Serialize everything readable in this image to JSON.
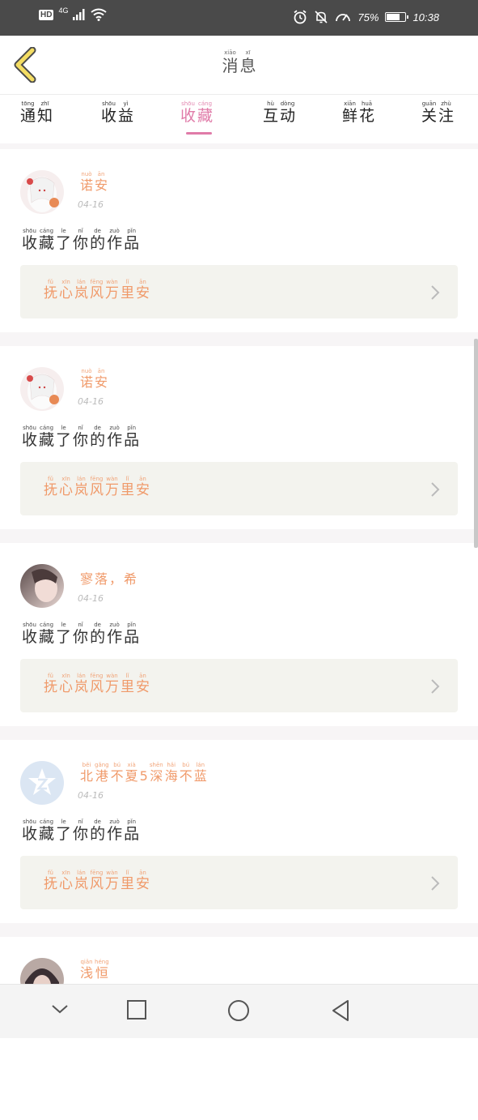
{
  "status_bar": {
    "hd": "HD",
    "network": "4G",
    "battery": "75%",
    "battery_level": 0.75,
    "time": "10:38",
    "icons": [
      "signal-icon",
      "wifi-icon",
      "alarm-icon",
      "mute-icon",
      "speed-icon",
      "battery-icon"
    ]
  },
  "header": {
    "title": [
      {
        "ch": "消",
        "py": "xiāo"
      },
      {
        "ch": "息",
        "py": "xī"
      }
    ],
    "back_icon": "chevron-left-icon"
  },
  "tabs": [
    {
      "label": [
        {
          "ch": "通",
          "py": "tōng"
        },
        {
          "ch": "知",
          "py": "zhī"
        }
      ],
      "active": false
    },
    {
      "label": [
        {
          "ch": "收",
          "py": "shōu"
        },
        {
          "ch": "益",
          "py": "yì"
        }
      ],
      "active": false
    },
    {
      "label": [
        {
          "ch": "收",
          "py": "shōu"
        },
        {
          "ch": "藏",
          "py": "cáng"
        }
      ],
      "active": true
    },
    {
      "label": [
        {
          "ch": "互",
          "py": "hù"
        },
        {
          "ch": "动",
          "py": "dòng"
        }
      ],
      "active": false
    },
    {
      "label": [
        {
          "ch": "鲜",
          "py": "xiān"
        },
        {
          "ch": "花",
          "py": "huā"
        }
      ],
      "active": false
    },
    {
      "label": [
        {
          "ch": "关",
          "py": "guān"
        },
        {
          "ch": "注",
          "py": "zhù"
        }
      ],
      "active": false
    }
  ],
  "colors": {
    "accent": "#e07ba8",
    "name": "#f09a6a",
    "box": "#f3f3ee"
  },
  "items": [
    {
      "user": [
        {
          "ch": "诺",
          "py": "nuò"
        },
        {
          "ch": "安",
          "py": "ān"
        }
      ],
      "avatar": "anime-girl-avatar",
      "date": "04-16",
      "action": [
        {
          "ch": "收",
          "py": "shōu"
        },
        {
          "ch": "藏",
          "py": "cáng"
        },
        {
          "ch": "了",
          "py": "le"
        },
        {
          "ch": "你",
          "py": "nǐ"
        },
        {
          "ch": "的",
          "py": "de"
        },
        {
          "ch": "作",
          "py": "zuò"
        },
        {
          "ch": "品",
          "py": "pǐn"
        }
      ],
      "work": [
        {
          "ch": "抚",
          "py": "fǔ"
        },
        {
          "ch": "心",
          "py": "xīn"
        },
        {
          "ch": "岚",
          "py": "lán"
        },
        {
          "ch": "风",
          "py": "fēng"
        },
        {
          "ch": "万",
          "py": "wàn"
        },
        {
          "ch": "里",
          "py": "lǐ"
        },
        {
          "ch": "安",
          "py": "ān"
        }
      ]
    },
    {
      "user": [
        {
          "ch": "诺",
          "py": "nuò"
        },
        {
          "ch": "安",
          "py": "ān"
        }
      ],
      "avatar": "anime-girl-avatar",
      "date": "04-16",
      "action": [
        {
          "ch": "收",
          "py": "shōu"
        },
        {
          "ch": "藏",
          "py": "cáng"
        },
        {
          "ch": "了",
          "py": "le"
        },
        {
          "ch": "你",
          "py": "nǐ"
        },
        {
          "ch": "的",
          "py": "de"
        },
        {
          "ch": "作",
          "py": "zuò"
        },
        {
          "ch": "品",
          "py": "pǐn"
        }
      ],
      "work": [
        {
          "ch": "抚",
          "py": "fǔ"
        },
        {
          "ch": "心",
          "py": "xīn"
        },
        {
          "ch": "岚",
          "py": "lán"
        },
        {
          "ch": "风",
          "py": "fēng"
        },
        {
          "ch": "万",
          "py": "wàn"
        },
        {
          "ch": "里",
          "py": "lǐ"
        },
        {
          "ch": "安",
          "py": "ān"
        }
      ]
    },
    {
      "user": [
        {
          "ch": "寥",
          "py": ""
        },
        {
          "ch": "落",
          "py": ""
        },
        {
          "ch": "，",
          "py": ""
        },
        {
          "ch": "希",
          "py": ""
        }
      ],
      "avatar": "photo-avatar",
      "date": "04-16",
      "action": [
        {
          "ch": "收",
          "py": "shōu"
        },
        {
          "ch": "藏",
          "py": "cáng"
        },
        {
          "ch": "了",
          "py": "le"
        },
        {
          "ch": "你",
          "py": "nǐ"
        },
        {
          "ch": "的",
          "py": "de"
        },
        {
          "ch": "作",
          "py": "zuò"
        },
        {
          "ch": "品",
          "py": "pǐn"
        }
      ],
      "work": [
        {
          "ch": "抚",
          "py": "fǔ"
        },
        {
          "ch": "心",
          "py": "xīn"
        },
        {
          "ch": "岚",
          "py": "lán"
        },
        {
          "ch": "风",
          "py": "fēng"
        },
        {
          "ch": "万",
          "py": "wàn"
        },
        {
          "ch": "里",
          "py": "lǐ"
        },
        {
          "ch": "安",
          "py": "ān"
        }
      ]
    },
    {
      "user": [
        {
          "ch": "北",
          "py": "běi"
        },
        {
          "ch": "港",
          "py": "gǎng"
        },
        {
          "ch": "不",
          "py": "bú"
        },
        {
          "ch": "夏",
          "py": "xià"
        },
        {
          "ch": "5",
          "py": ""
        },
        {
          "ch": "深",
          "py": "shēn"
        },
        {
          "ch": "海",
          "py": "hǎi"
        },
        {
          "ch": "不",
          "py": "bú"
        },
        {
          "ch": "蓝",
          "py": "lán"
        }
      ],
      "avatar": "default-avatar",
      "date": "04-16",
      "action": [
        {
          "ch": "收",
          "py": "shōu"
        },
        {
          "ch": "藏",
          "py": "cáng"
        },
        {
          "ch": "了",
          "py": "le"
        },
        {
          "ch": "你",
          "py": "nǐ"
        },
        {
          "ch": "的",
          "py": "de"
        },
        {
          "ch": "作",
          "py": "zuò"
        },
        {
          "ch": "品",
          "py": "pǐn"
        }
      ],
      "work": [
        {
          "ch": "抚",
          "py": "fǔ"
        },
        {
          "ch": "心",
          "py": "xīn"
        },
        {
          "ch": "岚",
          "py": "lán"
        },
        {
          "ch": "风",
          "py": "fēng"
        },
        {
          "ch": "万",
          "py": "wàn"
        },
        {
          "ch": "里",
          "py": "lǐ"
        },
        {
          "ch": "安",
          "py": "ān"
        }
      ]
    },
    {
      "user": [
        {
          "ch": "浅",
          "py": "qiǎn"
        },
        {
          "ch": "恒",
          "py": "héng"
        }
      ],
      "avatar": "photo-avatar",
      "date": "",
      "action": [],
      "work": []
    }
  ],
  "nav_bar": {
    "icons": [
      "collapse-icon",
      "recent-apps-icon",
      "home-icon",
      "back-icon"
    ]
  }
}
